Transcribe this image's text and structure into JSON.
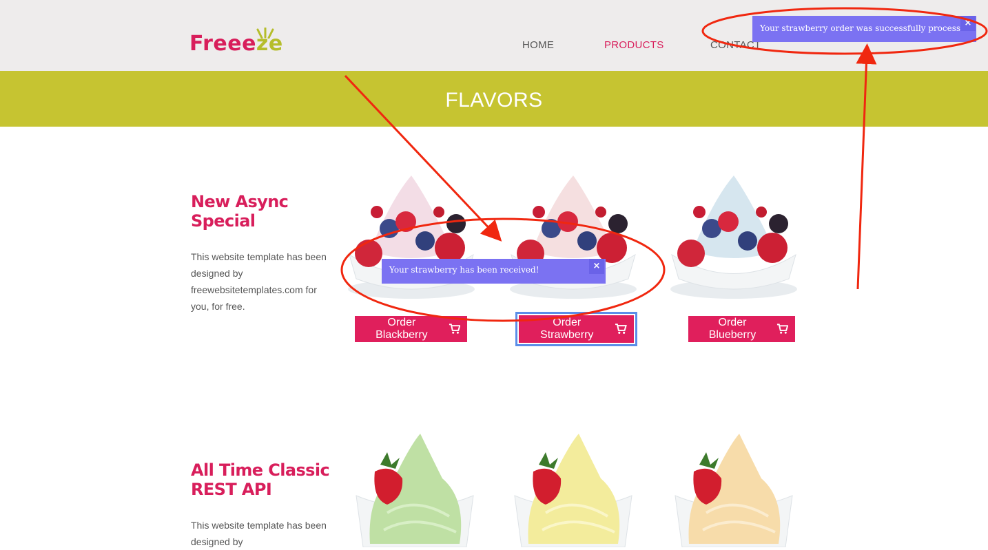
{
  "header": {
    "logo": {
      "part1": "Freee",
      "part2": "ze"
    },
    "nav": {
      "home": "HOME",
      "products": "PRODUCTS",
      "contact": "CONTACT"
    }
  },
  "banner": {
    "title": "FLAVORS"
  },
  "sections": [
    {
      "title_line1": "New Async",
      "title_line2": "Special",
      "text": "This website template has been designed by freewebsitetemplates.com for you, for free.",
      "buttons": {
        "blackberry": "Order Blackberry",
        "strawberry": "Order Strawberry",
        "blueberry": "Order Blueberry"
      }
    },
    {
      "title_line1": "All Time Classic",
      "title_line2": "REST API",
      "text": "This website template has been designed by"
    }
  ],
  "toasts": {
    "received": "Your strawberry has been received!",
    "processed": "Your strawberry order was successfully processed!",
    "close_symbol": "×"
  },
  "colors": {
    "brand_pink": "#d81e5b",
    "banner_green": "#c6c431",
    "toast_purple": "#7b72f2",
    "annotation_red": "#f0270f"
  }
}
